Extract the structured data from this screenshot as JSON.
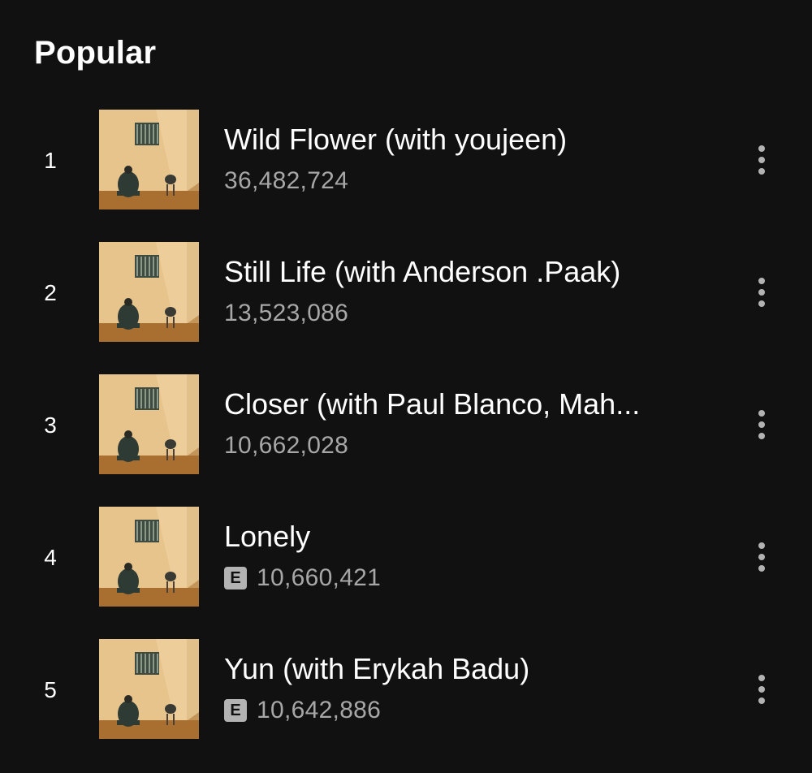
{
  "section": {
    "title": "Popular"
  },
  "tracks": [
    {
      "rank": "1",
      "title": "Wild Flower (with youjeen)",
      "plays": "36,482,724",
      "explicit": false
    },
    {
      "rank": "2",
      "title": "Still Life (with Anderson .Paak)",
      "plays": "13,523,086",
      "explicit": false
    },
    {
      "rank": "3",
      "title": "Closer (with Paul Blanco, Mah...",
      "plays": "10,662,028",
      "explicit": false
    },
    {
      "rank": "4",
      "title": "Lonely",
      "plays": "10,660,421",
      "explicit": true,
      "explicit_label": "E"
    },
    {
      "rank": "5",
      "title": "Yun (with Erykah Badu)",
      "plays": "10,642,886",
      "explicit": true,
      "explicit_label": "E"
    }
  ],
  "icons": {
    "more": "more-vertical-icon",
    "cover": "album-cover"
  },
  "colors": {
    "background": "#111111",
    "text_primary": "#ffffff",
    "text_secondary": "#a7a7a7",
    "badge": "#b3b3b3"
  }
}
